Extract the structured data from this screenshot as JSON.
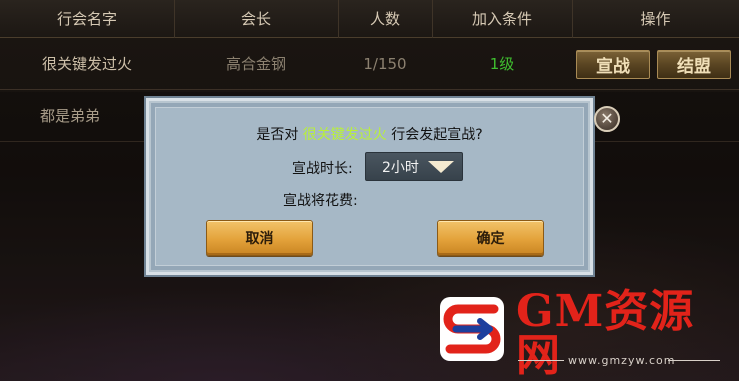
{
  "table": {
    "headers": [
      "行会名字",
      "会长",
      "人数",
      "加入条件",
      "操作"
    ],
    "rows": [
      {
        "name": "很关键发过火",
        "leader": "高合金钢",
        "members": "1/150",
        "requirement": "1级",
        "actions": [
          "宣战",
          "结盟"
        ]
      },
      {
        "name": "都是弟弟"
      }
    ]
  },
  "dialog": {
    "question_prefix": "是否对",
    "guild_name": "很关键发过火",
    "question_suffix": "行会发起宣战?",
    "duration_label": "宣战时长:",
    "duration_value": "2小时",
    "cost_label": "宣战将花费:",
    "cancel_label": "取消",
    "confirm_label": "确定",
    "close_icon": "close-icon"
  },
  "watermark": {
    "brand": "GM资源网",
    "url": "www.gmzyw.com"
  },
  "colors": {
    "guild_highlight": "#b9f03b",
    "requirement_green": "#3fbf2f",
    "watermark_red": "#e2231a",
    "watermark_blue": "#1c3f9e"
  }
}
